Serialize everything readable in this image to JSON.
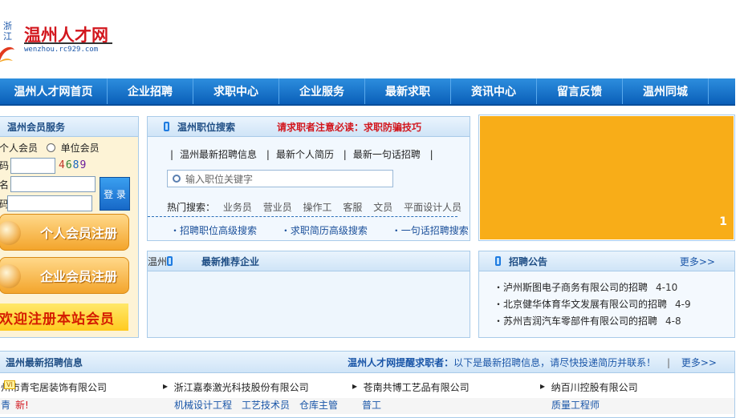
{
  "logo": {
    "province": "浙江",
    "name": "温州人才网",
    "domain": "wenzhou.rc929.com"
  },
  "nav": [
    "温州人才网首页",
    "企业招聘",
    "求职中心",
    "企业服务",
    "最新求职",
    "资讯中心",
    "留言反馈",
    "温州同城"
  ],
  "member": {
    "title": "温州会员服务",
    "radio_personal": "个人会员",
    "radio_company": "单位会员",
    "captcha_label": "码",
    "captcha_code": "4689",
    "username_label": "名",
    "password_label": "码",
    "login_label": "登 录",
    "personal_register": "个人会员注册",
    "company_register": "企业会员注册",
    "welcome": "欢迎注册本站会员"
  },
  "search": {
    "title": "温州职位搜索",
    "notice": "请求职者注意必读：求职防骗技巧",
    "quick_links": [
      "温州最新招聘信息",
      "最新个人简历",
      "最新一句话招聘"
    ],
    "placeholder": "输入职位关键字",
    "hot_label": "热门搜索：",
    "hot_keywords": [
      "业务员",
      "营业员",
      "操作工",
      "客服",
      "文员",
      "平面设计人员"
    ],
    "advanced": [
      "・招聘职位高级搜索",
      "・求职简历高级搜索",
      "・一句话招聘搜索"
    ]
  },
  "banner": {
    "slide_number": "1"
  },
  "recommend": {
    "prefix": "温州",
    "title": "最新推荐企业"
  },
  "announcements": {
    "title": "招聘公告",
    "more": "更多>>",
    "items": [
      {
        "text": "・泸州斯图电子商务有限公司的招聘",
        "date": "4-10"
      },
      {
        "text": "・北京健华体育华文发展有限公司的招聘",
        "date": "4-9"
      },
      {
        "text": "・苏州吉润汽车零部件有限公司的招聘",
        "date": "4-8"
      }
    ]
  },
  "latest": {
    "title": "温州最新招聘信息",
    "remind_bold": "温州人才网提醒求职者：",
    "remind_text": "以下是最新招聘信息，请尽快投递简历并联系！",
    "separator": "|",
    "more": "更多>>",
    "companies": [
      {
        "name": "州市青宅居装饰有限公司",
        "badge": "VI"
      },
      {
        "name": "浙江嘉泰激光科技股份有限公司",
        "badge": ""
      },
      {
        "name": "苍南共博工艺品有限公司",
        "badge": ""
      },
      {
        "name": "纳百川控股有限公司",
        "badge": ""
      }
    ],
    "jobs": {
      "col1_a": "青",
      "col1_new": "新!",
      "col2": [
        "机械设计工程",
        "工艺技术员",
        "仓库主管"
      ],
      "col3": [
        "普工"
      ],
      "col4": [
        "质量工程师"
      ]
    }
  },
  "colors": {
    "nav_blue": "#0a5fb8",
    "accent_red": "#d2161d",
    "banner_orange": "#f8ad18",
    "register_orange": "#f3a52c"
  }
}
